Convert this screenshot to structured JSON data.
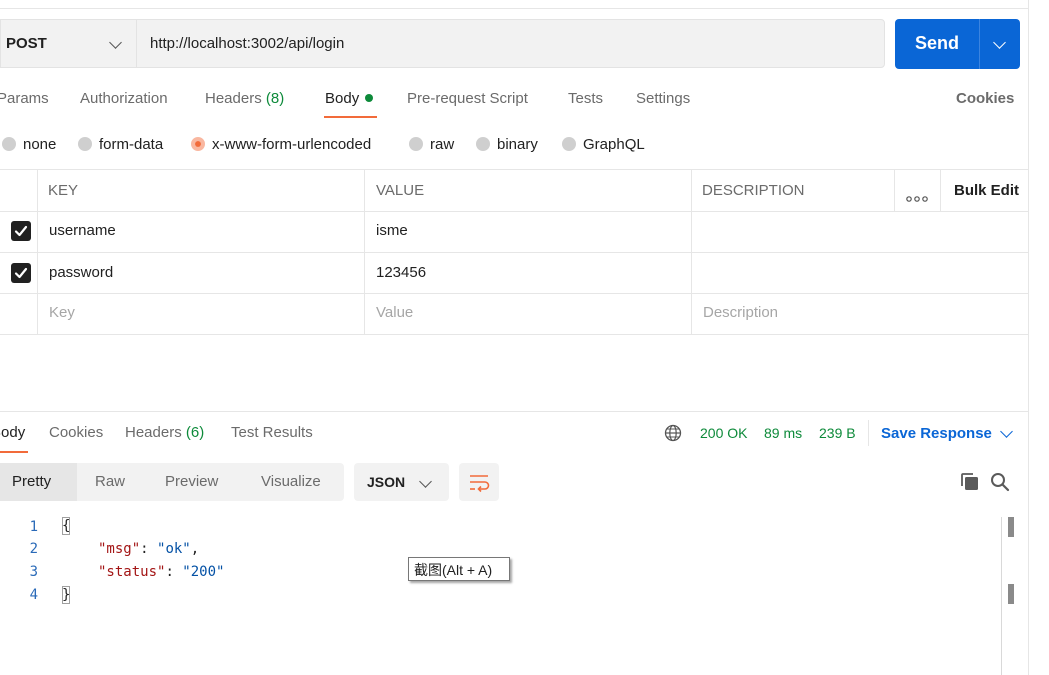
{
  "request": {
    "method": "POST",
    "url": "http://localhost:3002/api/login",
    "send_label": "Send"
  },
  "request_tabs": [
    {
      "label": "Params"
    },
    {
      "label": "Authorization"
    },
    {
      "label": "Headers",
      "count": "(8)"
    },
    {
      "label": "Body"
    },
    {
      "label": "Pre-request Script"
    },
    {
      "label": "Tests"
    },
    {
      "label": "Settings"
    }
  ],
  "cookies_link": "Cookies",
  "body_types": [
    {
      "label": "none"
    },
    {
      "label": "form-data"
    },
    {
      "label": "x-www-form-urlencoded",
      "selected": true
    },
    {
      "label": "raw"
    },
    {
      "label": "binary"
    },
    {
      "label": "GraphQL"
    }
  ],
  "params_table": {
    "headers": {
      "key": "KEY",
      "value": "VALUE",
      "description": "DESCRIPTION",
      "more": "ooo",
      "bulk_edit": "Bulk Edit"
    },
    "rows": [
      {
        "checked": true,
        "key": "username",
        "value": "isme",
        "description": ""
      },
      {
        "checked": true,
        "key": "password",
        "value": "123456",
        "description": ""
      }
    ],
    "placeholders": {
      "key": "Key",
      "value": "Value",
      "description": "Description"
    }
  },
  "response": {
    "tabs": [
      {
        "label": "Body"
      },
      {
        "label": "Cookies"
      },
      {
        "label": "Headers",
        "count": "(6)"
      },
      {
        "label": "Test Results"
      }
    ],
    "status": "200 OK",
    "time": "89 ms",
    "size": "239 B",
    "save_response": "Save Response",
    "view_modes": [
      "Pretty",
      "Raw",
      "Preview",
      "Visualize"
    ],
    "format": "JSON",
    "code_lines": [
      {
        "num": "1",
        "text": "{"
      },
      {
        "num": "2",
        "key": "\"msg\"",
        "value": "\"ok\"",
        "trail": ","
      },
      {
        "num": "3",
        "key": "\"status\"",
        "value": "\"200\"",
        "trail": ""
      },
      {
        "num": "4",
        "text": "}"
      }
    ]
  },
  "tooltip": "截图(Alt + A)",
  "colors": {
    "accent": "#0a66d6",
    "active_tab": "#f26b3a",
    "status_ok": "#0d8a3a"
  }
}
